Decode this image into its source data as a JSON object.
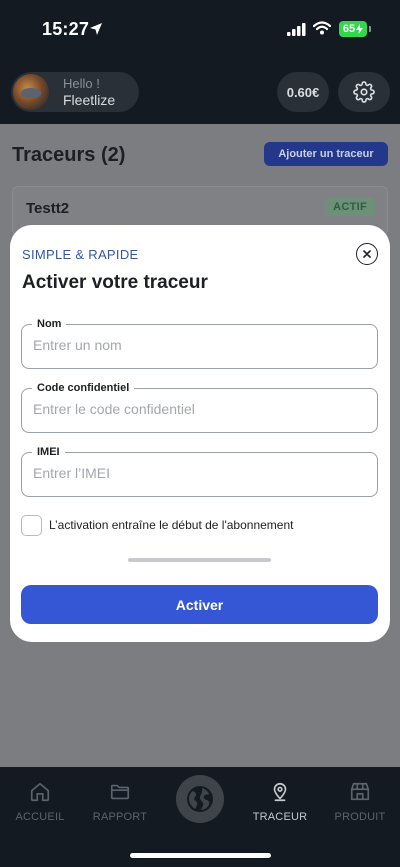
{
  "status_bar": {
    "time": "15:27",
    "battery": "65"
  },
  "header": {
    "greeting": "Hello !",
    "user_name": "Fleetlize",
    "balance": "0.60€"
  },
  "page": {
    "title": "Traceurs (2)",
    "add_button_label": "Ajouter un traceur",
    "trackers": [
      {
        "name": "Testt2",
        "status": "ACTIF"
      }
    ]
  },
  "modal": {
    "eyebrow": "SIMPLE & RAPIDE",
    "title": "Activer votre traceur",
    "fields": [
      {
        "label": "Nom",
        "placeholder": "Entrer un nom",
        "value": ""
      },
      {
        "label": "Code confidentiel",
        "placeholder": "Entrer le code confidentiel",
        "value": ""
      },
      {
        "label": "IMEI",
        "placeholder": "Entrer l’IMEI",
        "value": ""
      }
    ],
    "checkbox_label": "L’activation entraîne le début de l'abonnement",
    "checkbox_checked": false,
    "submit_label": "Activer"
  },
  "tab_bar": {
    "tabs": [
      {
        "label": "ACCUEIL",
        "icon": "home-icon"
      },
      {
        "label": "RAPPORT",
        "icon": "folder-icon"
      },
      {
        "label": "",
        "icon": "globe-icon"
      },
      {
        "label": "TRACEUR",
        "icon": "location-pin-icon",
        "active": true
      },
      {
        "label": "PRODUIT",
        "icon": "store-icon"
      }
    ]
  },
  "colors": {
    "accent": "#3557d6",
    "eyebrow": "#3656a6",
    "active_badge": "#6e8f78",
    "background": "#141a22"
  }
}
